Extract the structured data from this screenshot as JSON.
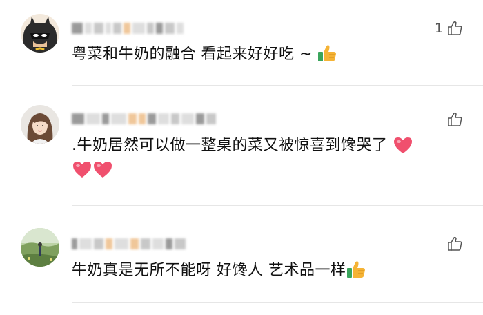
{
  "comments": [
    {
      "avatar": "batman-avatar",
      "text": "粤菜和牛奶的融合 看起来好好吃 ~",
      "emoji": "thumbs-up-icon",
      "likes": "1",
      "like_icon": "thumbs-up-outline-icon"
    },
    {
      "avatar": "woman-portrait-avatar",
      "text": ".牛奶居然可以做一整桌的菜又被惊喜到馋哭了",
      "emoji": "heart-icon",
      "likes": "",
      "like_icon": "thumbs-up-outline-icon"
    },
    {
      "avatar": "landscape-avatar",
      "text": "牛奶真是无所不能呀 好馋人 艺术品一样",
      "emoji": "thumbs-up-icon",
      "likes": "",
      "like_icon": "thumbs-up-outline-icon"
    }
  ],
  "colors": {
    "heart": "#f0506e",
    "thumb": "#f5b335",
    "thumb_cuff": "#3aa55c",
    "divider": "#e6e6e6"
  }
}
